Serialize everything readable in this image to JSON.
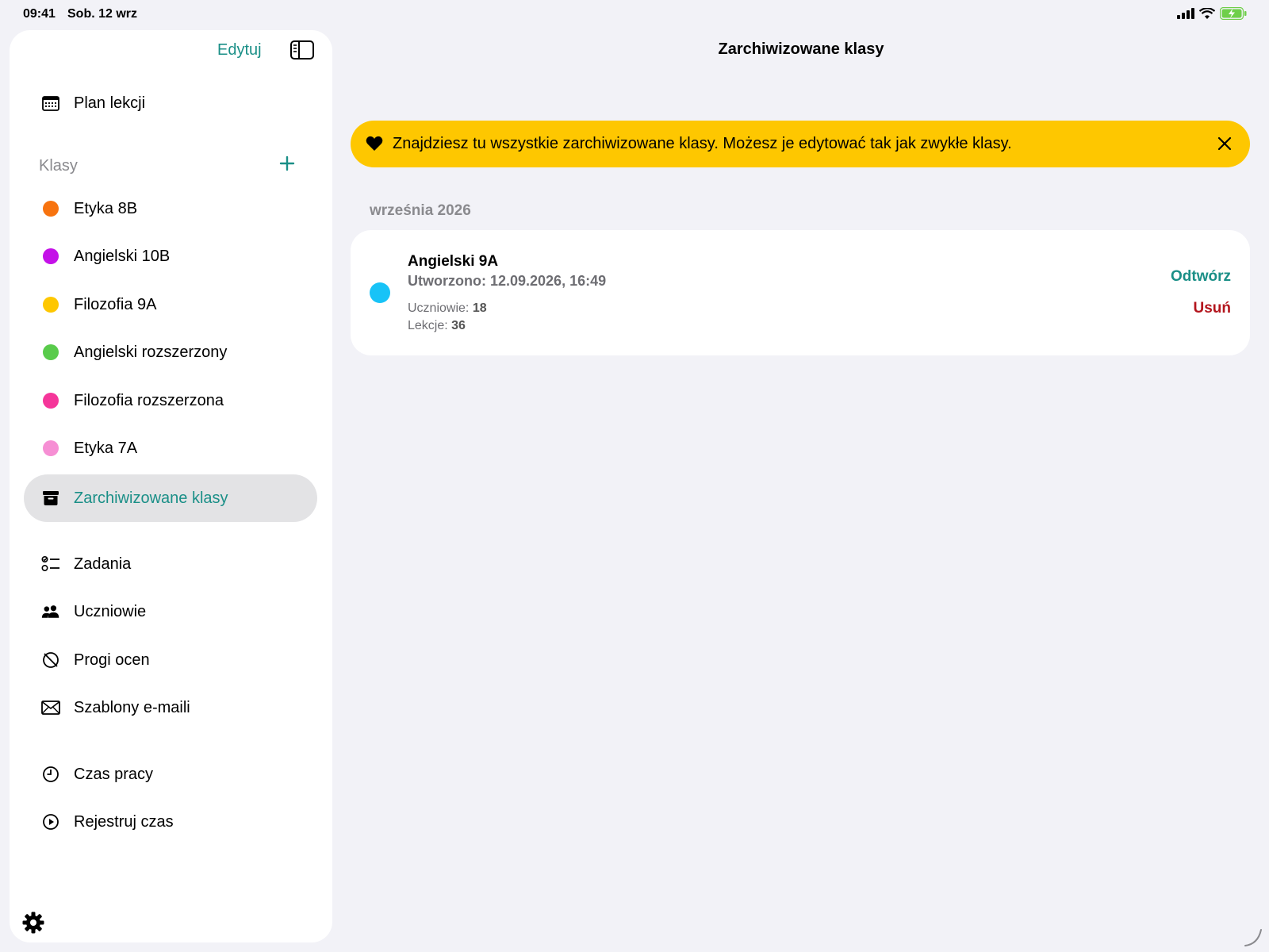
{
  "status_bar": {
    "time": "09:41",
    "date": "Sob. 12 wrz"
  },
  "sidebar": {
    "edit_label": "Edytuj",
    "toggle_icon": "sidebar-icon",
    "schedule": {
      "label": "Plan lekcji",
      "icon": "calendar-icon"
    },
    "classes_section": {
      "label": "Klasy",
      "add_icon": "plus-icon",
      "items": [
        {
          "label": "Etyka 8B",
          "color": "#f7730f"
        },
        {
          "label": "Angielski 10B",
          "color": "#c411e8"
        },
        {
          "label": "Filozofia 9A",
          "color": "#fec700"
        },
        {
          "label": "Angielski rozszerzony",
          "color": "#59cb4b"
        },
        {
          "label": "Filozofia rozszerzona",
          "color": "#f5369a"
        },
        {
          "label": "Etyka 7A",
          "color": "#f68fd4"
        }
      ],
      "archived": {
        "label": "Zarchiwizowane klasy",
        "icon": "archive-box-icon",
        "color": "#1a8f87"
      }
    },
    "tools": [
      {
        "label": "Zadania",
        "icon": "checklist-icon"
      },
      {
        "label": "Uczniowie",
        "icon": "people-icon"
      },
      {
        "label": "Progi ocen",
        "icon": "grade-thresholds-icon"
      },
      {
        "label": "Szablony e-maili",
        "icon": "envelope-icon"
      }
    ],
    "time_tools": [
      {
        "label": "Czas pracy",
        "icon": "clock-icon"
      },
      {
        "label": "Rejestruj czas",
        "icon": "play-circle-icon"
      }
    ],
    "settings_icon": "gear-icon"
  },
  "main": {
    "title": "Zarchiwizowane klasy",
    "banner": {
      "text": "Znajdziesz tu wszystkie zarchiwizowane klasy. Możesz je edytować tak jak zwykłe klasy.",
      "bg_color": "#fec700",
      "icon": "heart-icon",
      "close_icon": "close-icon"
    },
    "groups": [
      {
        "month": "września 2026",
        "classes": [
          {
            "name": "Angielski 9A",
            "color": "#18c3f7",
            "created": "Utworzono: 12.09.2026, 16:49",
            "students_label": "Uczniowie:",
            "students_value": "18",
            "lessons_label": "Lekcje:",
            "lessons_value": "36",
            "restore_label": "Odtwórz",
            "delete_label": "Usuń"
          }
        ]
      }
    ]
  }
}
